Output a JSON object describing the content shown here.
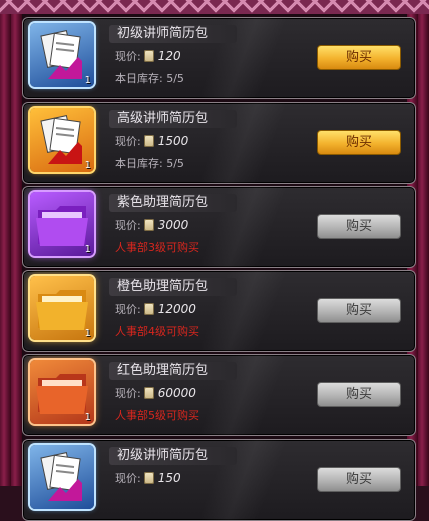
{
  "items": [
    {
      "name": "初级讲师简历包",
      "price_label": "现价:",
      "price": "120",
      "sub": "本日库存: 5/5",
      "qty": "1",
      "button": "购买",
      "button_state": "active",
      "thumb": "teacher-resume-icon"
    },
    {
      "name": "高级讲师简历包",
      "price_label": "现价:",
      "price": "1500",
      "sub": "本日库存: 5/5",
      "qty": "1",
      "button": "购买",
      "button_state": "active",
      "thumb": "teacher-resume-icon"
    },
    {
      "name": "紫色助理简历包",
      "price_label": "现价:",
      "price": "3000",
      "sub": "人事部3级可购买",
      "qty": "1",
      "button": "购买",
      "button_state": "disabled",
      "thumb": "folder-icon"
    },
    {
      "name": "橙色助理简历包",
      "price_label": "现价:",
      "price": "12000",
      "sub": "人事部4级可购买",
      "qty": "1",
      "button": "购买",
      "button_state": "disabled",
      "thumb": "folder-icon"
    },
    {
      "name": "红色助理简历包",
      "price_label": "现价:",
      "price": "60000",
      "sub": "人事部5级可购买",
      "qty": "1",
      "button": "购买",
      "button_state": "disabled",
      "thumb": "folder-icon"
    },
    {
      "name": "初级讲师简历包",
      "price_label": "现价:",
      "price": "150",
      "sub": "",
      "qty": "",
      "button": "购买",
      "button_state": "disabled",
      "thumb": "teacher-resume-icon"
    }
  ],
  "colors": {
    "restriction_text": "#d7261e",
    "active_button": "#f3b22d",
    "disabled_button": "#b4b4b4"
  }
}
